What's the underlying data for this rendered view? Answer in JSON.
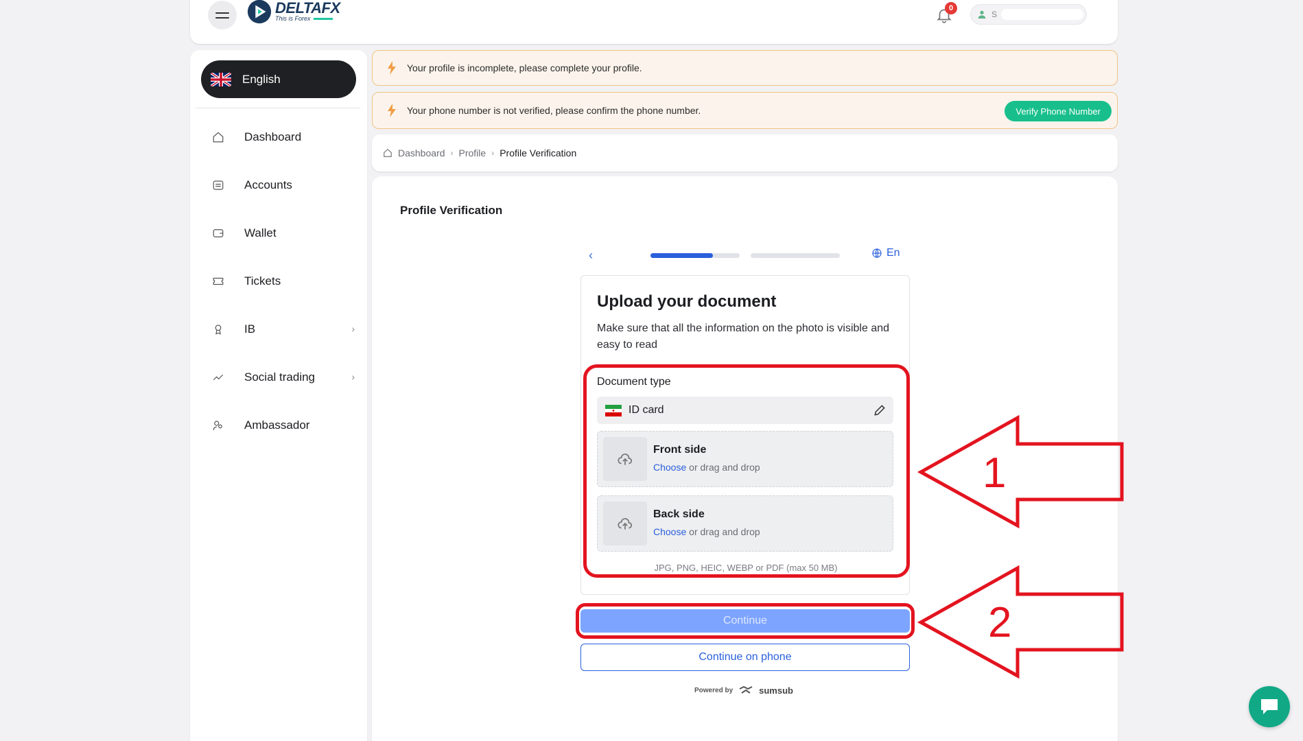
{
  "brand": {
    "name": "DELTAFX",
    "tagline": "This is Forex"
  },
  "header": {
    "notification_count": "0",
    "user_initial": "S"
  },
  "sidebar": {
    "language": "English",
    "items": [
      {
        "label": "Dashboard",
        "icon": "home-icon"
      },
      {
        "label": "Accounts",
        "icon": "accounts-icon"
      },
      {
        "label": "Wallet",
        "icon": "wallet-icon"
      },
      {
        "label": "Tickets",
        "icon": "ticket-icon"
      },
      {
        "label": "IB",
        "icon": "award-icon",
        "has_submenu": true
      },
      {
        "label": "Social trading",
        "icon": "trend-icon",
        "has_submenu": true
      },
      {
        "label": "Ambassador",
        "icon": "users-icon"
      }
    ]
  },
  "alerts": {
    "profile": "Your profile is incomplete, please complete your profile.",
    "phone": "Your phone number is not verified, please confirm the phone number.",
    "verify_button": "Verify Phone Number"
  },
  "breadcrumb": {
    "items": [
      "Dashboard",
      "Profile",
      "Profile Verification"
    ]
  },
  "main": {
    "title": "Profile Verification",
    "progress": {
      "step1_fill": 0.7,
      "step2_fill": 0
    },
    "language_selector": "En",
    "upload": {
      "title": "Upload your document",
      "description": "Make sure that all the information on the photo is visible and easy to read",
      "doc_type_label": "Document type",
      "doc_type_value": "ID card",
      "front_title": "Front side",
      "back_title": "Back side",
      "choose_link": "Choose",
      "hint_suffix": " or drag and drop",
      "formats": "JPG, PNG, HEIC, WEBP or PDF (max 50 MB)"
    },
    "continue_button": "Continue",
    "continue_phone_button": "Continue on phone",
    "powered_by": "Powered by",
    "powered_brand": "sumsub"
  },
  "annotations": {
    "label_1": "1",
    "label_2": "2",
    "color": "#e3141f"
  },
  "colors": {
    "accent": "#2a5fdc",
    "green": "#18bf8c",
    "dark": "#1f2023",
    "alert_border": "#f0c285"
  }
}
